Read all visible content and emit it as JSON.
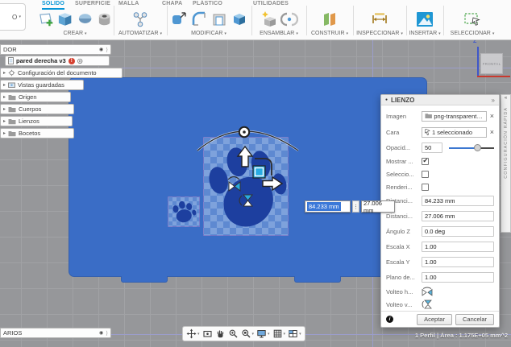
{
  "icons": {
    "caret_down": "▾",
    "expander": "▸",
    "dock": "◉",
    "panel_arrow": "»",
    "strip_arrow": "«",
    "close": "×",
    "unsaved": "!",
    "target": "◎",
    "grip_dots": "⋮",
    "info": "i",
    "bullet": "●"
  },
  "ui": {
    "workspace_partial": "O",
    "browser_header": "DOR",
    "comments_header": "ARIOS",
    "right_strip_label": "CONFIGURACIÓN RÁPIDA"
  },
  "tabs": [
    {
      "label": "SOLIDO",
      "active": true
    },
    {
      "label": "SUPERFICIE",
      "active": false
    },
    {
      "label": "MALLA",
      "active": false
    },
    {
      "label": "CHAPA",
      "active": false
    },
    {
      "label": "PLÁSTICO",
      "active": false
    },
    {
      "label": "UTILIDADES",
      "active": false
    }
  ],
  "groups": [
    {
      "label": "CREAR"
    },
    {
      "label": "AUTOMATIZAR"
    },
    {
      "label": "MODIFICAR"
    },
    {
      "label": "ENSAMBLAR"
    },
    {
      "label": "CONSTRUIR"
    },
    {
      "label": "INSPECCIONAR"
    },
    {
      "label": "INSERTAR"
    },
    {
      "label": "SELECCIONAR"
    }
  ],
  "browser": {
    "root": {
      "label": "pared derecha v3"
    },
    "items": [
      {
        "label": "Configuración del documento"
      },
      {
        "label": "Vistas guardadas"
      },
      {
        "label": "Origen"
      },
      {
        "label": "Cuerpos"
      },
      {
        "label": "Lienzos"
      },
      {
        "label": "Bocetos"
      }
    ]
  },
  "viewport": {
    "floating": {
      "value_x": "84.233 mm",
      "value_y": "27.006 mm"
    },
    "viewcube": {
      "face": "FRONTAL",
      "axis_z": "Z"
    },
    "status": "1 Perfil | Área : 1.175E+05 mm^2"
  },
  "dialog": {
    "title": "LIENZO",
    "fields": {
      "imagen": {
        "label": "Imagen",
        "value": "png-transparent-c..."
      },
      "cara": {
        "label": "Cara",
        "value": "1 seleccionado"
      },
      "opacidad": {
        "label": "Opacid...",
        "value": "50"
      },
      "mostrar": {
        "label": "Mostrar ...",
        "checked": true
      },
      "seleccionable": {
        "label": "Seleccio...",
        "checked": false
      },
      "renderizable": {
        "label": "Renderi...",
        "checked": false
      },
      "distancia_x": {
        "label": "Distanci...",
        "value": "84.233 mm"
      },
      "distancia_y": {
        "label": "Distanci...",
        "value": "27.006 mm"
      },
      "angulo": {
        "label": "Ángulo Z",
        "value": "0.0 deg"
      },
      "escala_x": {
        "label": "Escala X",
        "value": "1.00"
      },
      "escala_y": {
        "label": "Escala Y",
        "value": "1.00"
      },
      "plano": {
        "label": "Plano de...",
        "value": "1.00"
      },
      "volteo_h": {
        "label": "Volteo h..."
      },
      "volteo_v": {
        "label": "Volteo v..."
      }
    },
    "footer": {
      "accept": "Aceptar",
      "cancel": "Cancelar"
    }
  },
  "colors": {
    "accent_blue": "#0696d7",
    "wall_blue": "#3a6dc6",
    "paw_navy": "#1d3f9f",
    "handle_cyan": "#29abe2",
    "selection_blue": "#3b78d8"
  }
}
